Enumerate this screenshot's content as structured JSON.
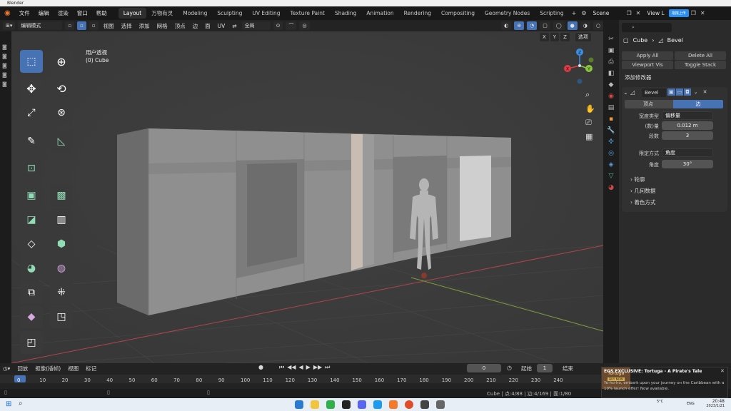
{
  "window": {
    "title": "Blender"
  },
  "menu": [
    "文件",
    "编辑",
    "渲染",
    "窗口",
    "帮助"
  ],
  "workspaces": [
    "Layout",
    "万物有灵",
    "Modeling",
    "Sculpting",
    "UV Editing",
    "Texture Paint",
    "Shading",
    "Animation",
    "Rendering",
    "Compositing",
    "Geometry Nodes",
    "Scripting"
  ],
  "scene": {
    "label": "Scene",
    "view_layer": "View L",
    "badge": "拖拽上传"
  },
  "header": {
    "mode": "编辑模式",
    "items": [
      "视图",
      "选择",
      "添加",
      "网格",
      "顶点",
      "边",
      "面",
      "UV"
    ],
    "transform": "全局",
    "axes": [
      "X",
      "Y",
      "Z"
    ],
    "options": "选项"
  },
  "viewport": {
    "view_name": "用户透视",
    "object_name": "(0) Cube"
  },
  "gizmo": {
    "x": "X",
    "y": "Y",
    "z": "Z"
  },
  "properties": {
    "object": "Cube",
    "modifier_name": "Bevel",
    "apply_all": "Apply All",
    "delete_all": "Delete All",
    "viewport_vis": "Viewport Vis",
    "toggle_stack": "Toggle Stack",
    "add_modifier": "添加修改器",
    "modifier_title": "Bevel",
    "tab_vertex": "顶点",
    "tab_edge": "边",
    "width_type_label": "宽度类型",
    "width_type_value": "偏移量",
    "amount_label": "(数)量",
    "amount_value": "0.012 m",
    "segments_label": "段数",
    "segments_value": "3",
    "limit_label": "限定方式",
    "limit_value": "角度",
    "angle_label": "角度",
    "angle_value": "30°",
    "sections": [
      "轮廓",
      "几何数据",
      "着色方式"
    ]
  },
  "timeline": {
    "menus": [
      "回放",
      "抠像(插帧)",
      "视图",
      "标记"
    ],
    "current_frame": "0",
    "start_label": "起始",
    "start_value": "1",
    "end_label": "结束",
    "ticks": [
      "0",
      "10",
      "20",
      "30",
      "40",
      "50",
      "60",
      "70",
      "80",
      "90",
      "100",
      "110",
      "120",
      "130",
      "140",
      "150",
      "160",
      "170",
      "180",
      "190",
      "200",
      "210",
      "220",
      "230",
      "240"
    ]
  },
  "status": {
    "text": "Cube | 点:4/88 | 边:4/169 | 面:1/80"
  },
  "notification": {
    "title": "EGS EXCLUSIVE: Tortuga - A Pirate's Tale",
    "body": "Yo-ho-ho, embark upon your journey on the Caribbean with a 10% launch offer! Now available.",
    "thumb_title": "Tortuga",
    "thumb_button": "BUY NOW"
  },
  "taskbar": {
    "time": "20:48",
    "date": "2023/1/21",
    "lang": "ENG",
    "weather": "5°C"
  },
  "colors": {
    "accent": "#4772b3",
    "axis_x": "#e03a45",
    "axis_y": "#8ac53d",
    "axis_z": "#3a8ee6"
  }
}
